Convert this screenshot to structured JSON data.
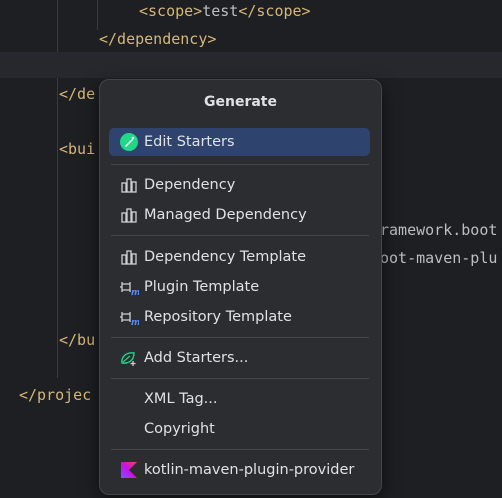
{
  "editor": {
    "lines": [
      {
        "kind": "tag-text",
        "open": "<scope>",
        "text": "test",
        "close": "</scope>"
      },
      {
        "kind": "tag",
        "text": "</dependency>"
      },
      {
        "kind": "tag",
        "text": "</de"
      },
      {
        "kind": "tag",
        "text": "<bui"
      },
      {
        "kind": "text",
        "text": "ramework.boot"
      },
      {
        "kind": "text",
        "text": "oot-maven-plu"
      },
      {
        "kind": "tag",
        "text": "</bu"
      },
      {
        "kind": "tag",
        "text": "</projec"
      }
    ]
  },
  "popup": {
    "title": "Generate",
    "items": [
      {
        "label": "Edit Starters",
        "icon": "spring-edit-icon",
        "selected": true
      },
      {
        "label": "Dependency",
        "icon": "maven-dependency-icon"
      },
      {
        "label": "Managed Dependency",
        "icon": "maven-dependency-icon"
      },
      {
        "label": "Dependency Template",
        "icon": "maven-dependency-icon"
      },
      {
        "label": "Plugin Template",
        "icon": "maven-plugin-icon"
      },
      {
        "label": "Repository Template",
        "icon": "maven-plugin-icon"
      },
      {
        "label": "Add Starters...",
        "icon": "spring-add-icon"
      },
      {
        "label": "XML Tag...",
        "icon": ""
      },
      {
        "label": "Copyright",
        "icon": ""
      },
      {
        "label": "kotlin-maven-plugin-provider",
        "icon": "kotlin-icon"
      }
    ]
  },
  "colors": {
    "editor_bg": "#1e1f22",
    "tag": "#d5b778",
    "text": "#bcbec4",
    "popup_bg": "#2b2d30",
    "selection": "#2e436e",
    "accent": "#21d789"
  }
}
